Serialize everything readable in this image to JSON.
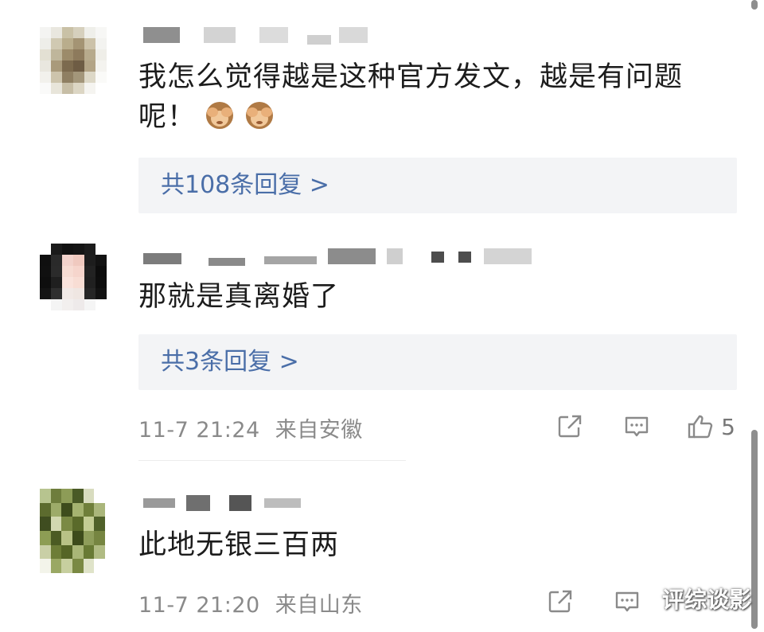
{
  "comments": [
    {
      "text_line1": "我怎么觉得越是这种官方发文，越是有问题",
      "text_line2": "呢！",
      "emojis": [
        "see-no-evil-monkey",
        "see-no-evil-monkey"
      ],
      "replies_label": "共108条回复 >"
    },
    {
      "text": "那就是真离婚了",
      "replies_label": "共3条回复 >",
      "time": "11-7 21:24",
      "location": "来自安徽",
      "like_count": "5"
    },
    {
      "text": "此地无银三百两",
      "time": "11-7 21:20",
      "location": "来自山东"
    }
  ],
  "icons": {
    "share": "share-icon",
    "comment": "comment-icon",
    "like": "thumbs-up-icon"
  },
  "watermark": "评综谈影",
  "colors": {
    "reply_link": "#4a6ea8",
    "reply_bg": "#f3f4f6",
    "meta_text": "#8a8a8a"
  }
}
